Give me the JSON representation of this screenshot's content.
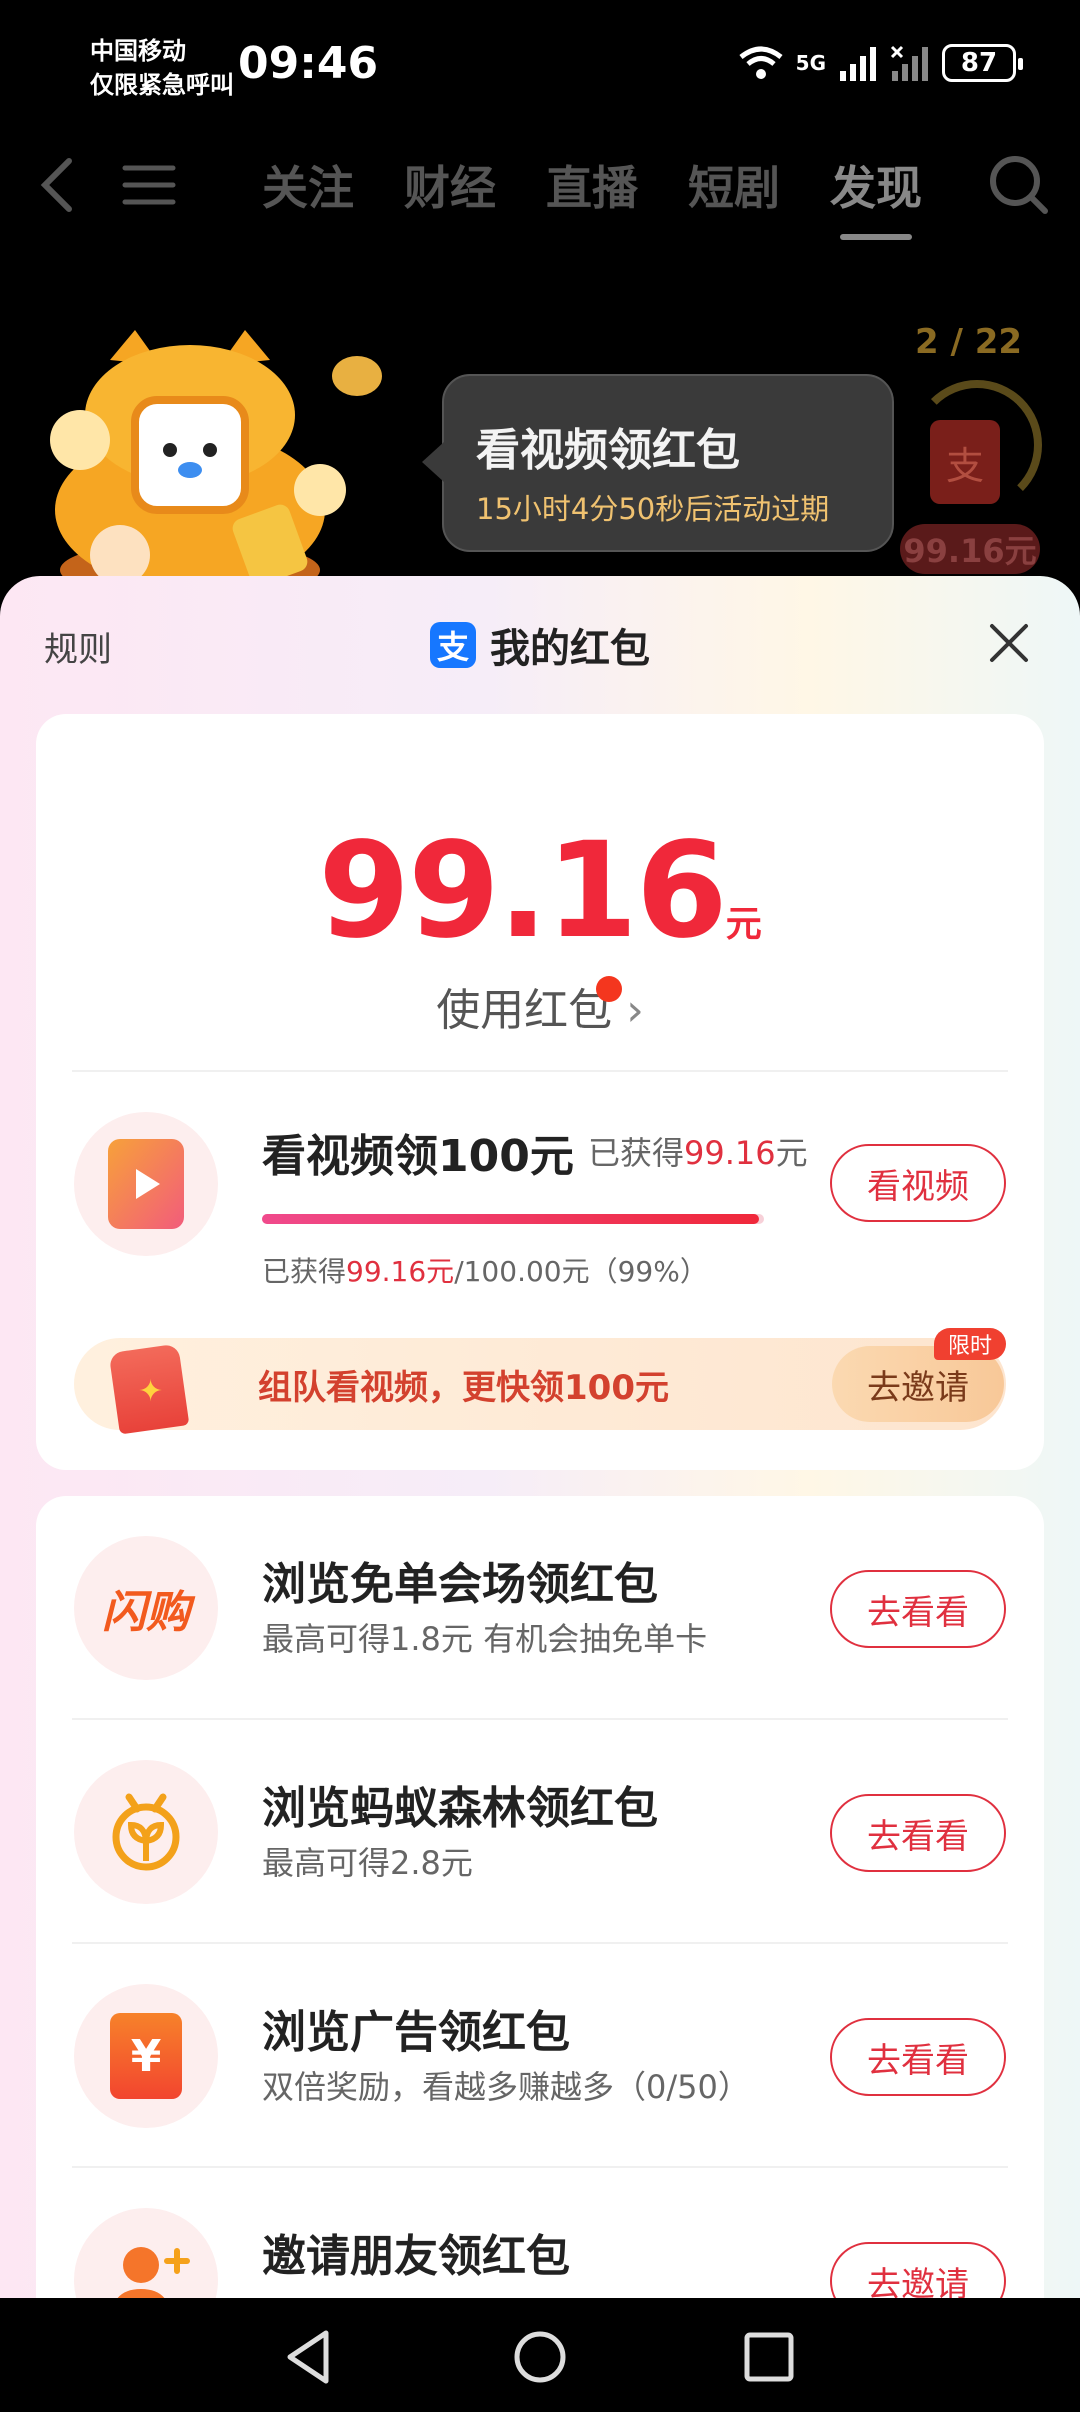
{
  "status": {
    "carrier_line1": "中国移动",
    "carrier_line2": "仅限紧急呼叫",
    "time": "09:46",
    "network": "5G",
    "battery": "87"
  },
  "nav": {
    "tabs": [
      "关注",
      "财经",
      "直播",
      "短剧",
      "发现"
    ],
    "active_tab": "发现"
  },
  "promo": {
    "title": "看视频领红包",
    "countdown": "15小时4分50秒后活动过期",
    "counter": "2 / 22",
    "badge_amount": "99.16元",
    "envelope_glyph": "支"
  },
  "sheet": {
    "rules": "规则",
    "title": "我的红包",
    "amount": "99.16",
    "unit": "元",
    "use_link": "使用红包",
    "chevron": "›"
  },
  "video_task": {
    "title": "看视频领100元",
    "earned_label": "已获得",
    "earned_amount": "99.16",
    "earned_unit": "元",
    "progress_prefix": "已获得",
    "progress_amount": "99.16元",
    "progress_suffix": "/100.00元（99%）",
    "progress": 0.99,
    "button": "看视频"
  },
  "team": {
    "text": "组队看视频，更快领100元",
    "button": "去邀请",
    "badge": "限时"
  },
  "tasks": [
    {
      "icon": "闪购",
      "title": "浏览免单会场领红包",
      "desc": "最高可得1.8元 有机会抽免单卡",
      "button": "去看看"
    },
    {
      "icon": "ant-forest",
      "title": "浏览蚂蚁森林领红包",
      "desc": "最高可得2.8元",
      "button": "去看看"
    },
    {
      "icon": "¥",
      "title": "浏览广告领红包",
      "desc": "双倍奖励，看越多赚越多（0/50）",
      "button": "去看看"
    },
    {
      "icon": "invite-user",
      "title": "邀请朋友领红包",
      "desc": "",
      "button": "去邀请"
    }
  ],
  "colors": {
    "accent": "#e0303f",
    "amount": "#f0283a",
    "alipay": "#1677ff"
  }
}
